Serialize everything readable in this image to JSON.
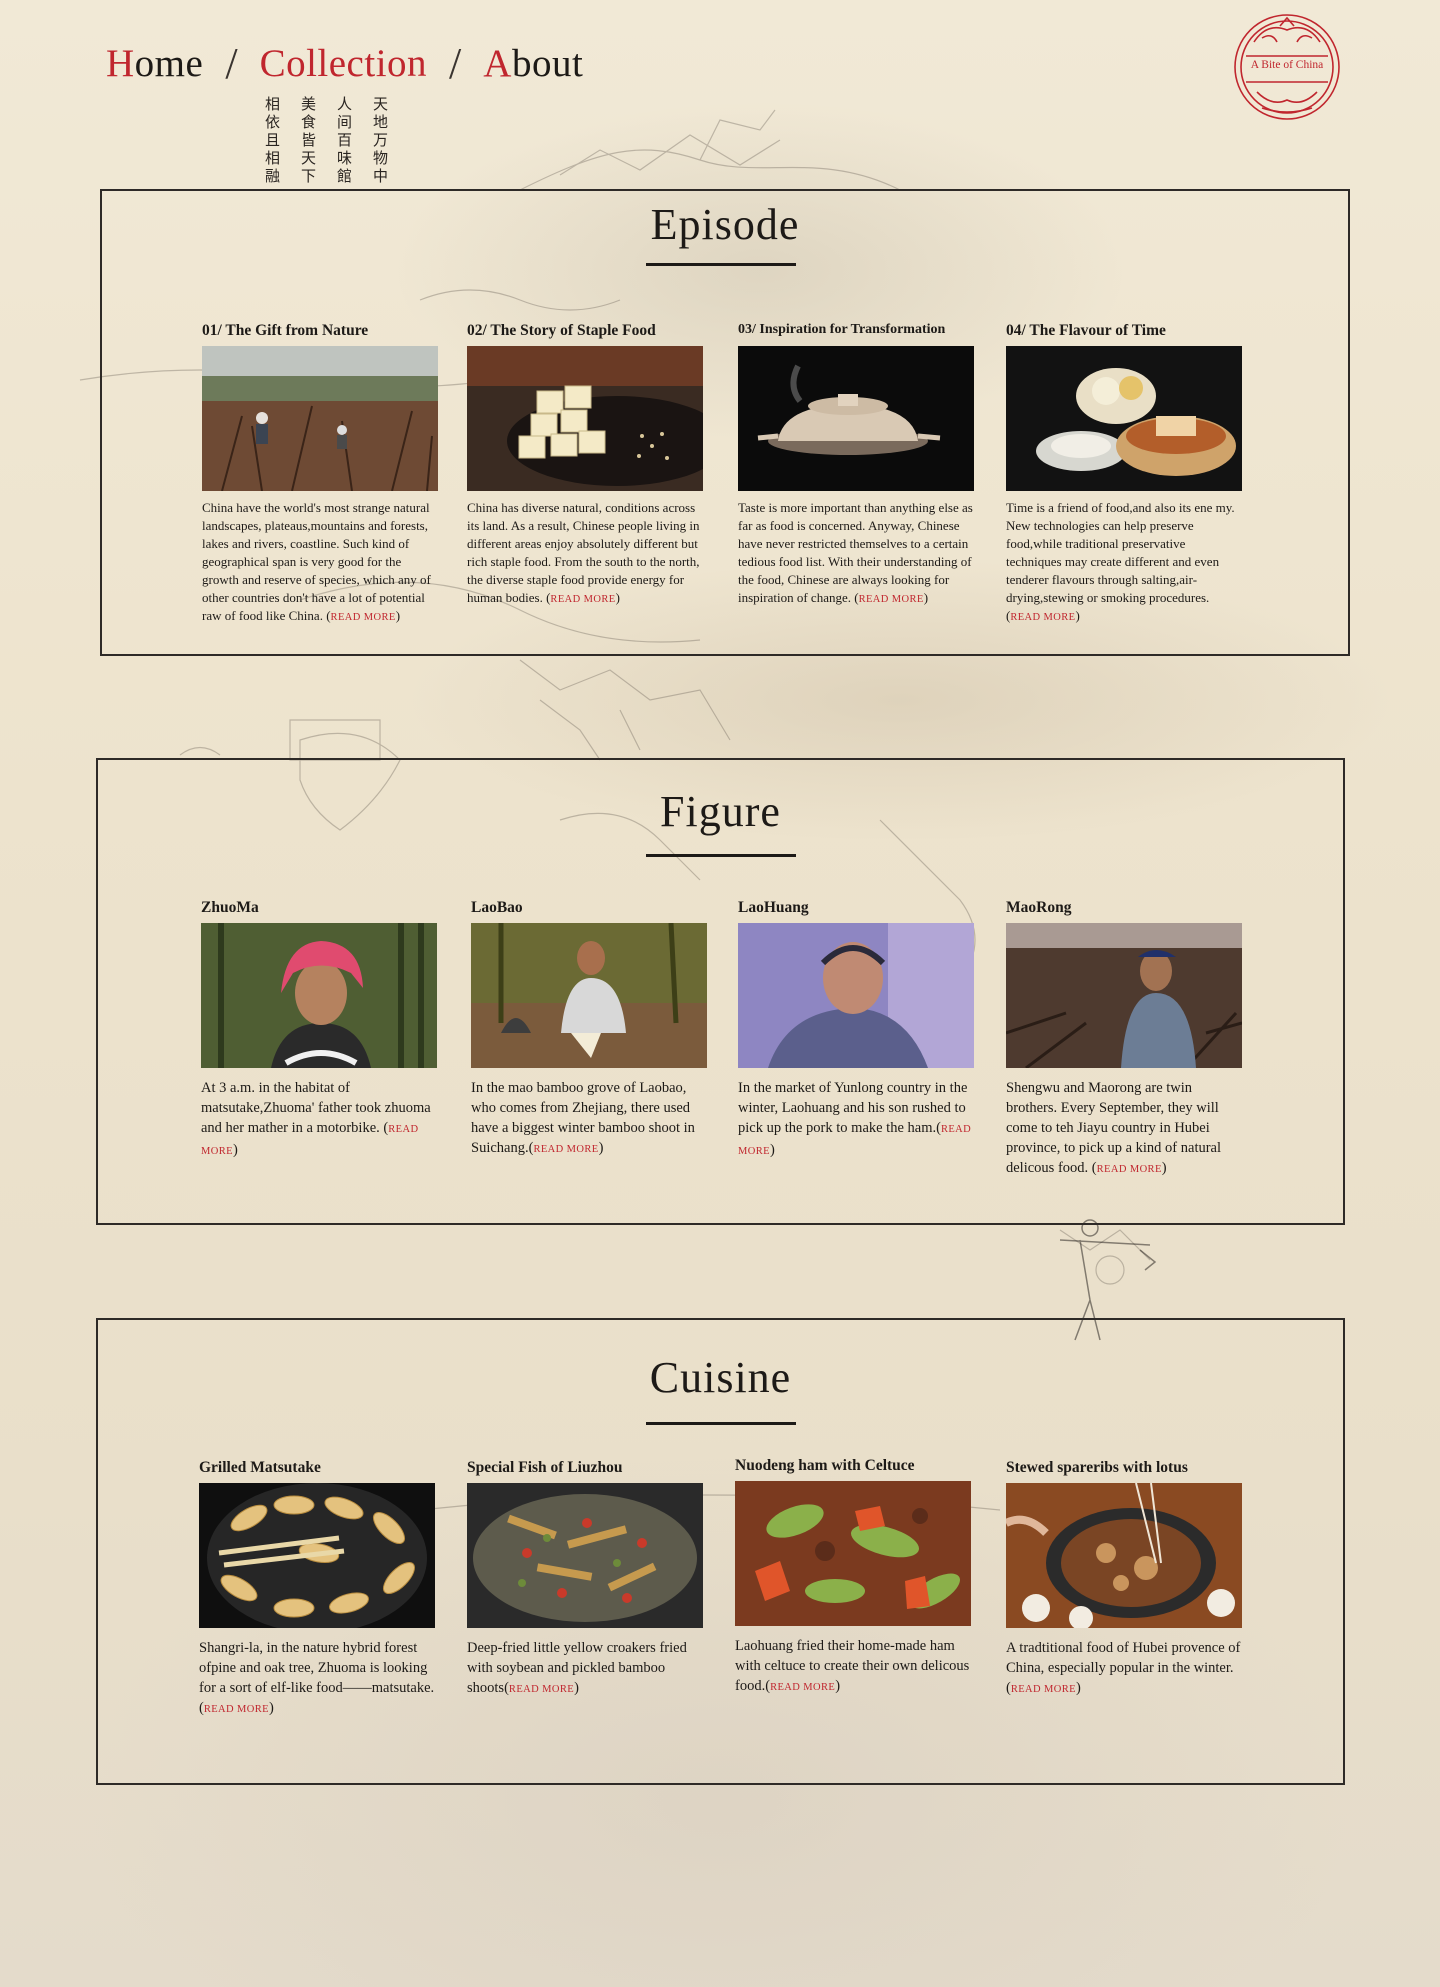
{
  "nav": {
    "home": {
      "first": "H",
      "rest": "ome"
    },
    "separator": "/",
    "collection": "Collection",
    "about": {
      "first": "A",
      "rest": "bout"
    }
  },
  "poem": [
    "天地万物中",
    "人间百味館",
    "美食皆天下",
    "相依且相融"
  ],
  "seal": {
    "text": "A Bite of China"
  },
  "read_more": "READ MORE",
  "episode": {
    "title": "Episode",
    "cards": [
      {
        "title": "01/  The Gift from Nature",
        "text": "China have the world's most strange natural landscapes, plateaus,mountains and forests, lakes and rivers, coastline. Such kind of geographical span is very good for the growth and reserve of species, which any of other countries don't have a lot of potential raw of food like China."
      },
      {
        "title": "02/ The Story of Staple Food",
        "text": "China has diverse natural, conditions across its land. As a result, Chinese people living in different areas enjoy absolutely different but rich staple food. From the south to the north, the diverse staple food provide energy for human bodies."
      },
      {
        "title": "03/ Inspiration for Transformation",
        "text": "Taste is more important than anything else as far as food is concerned. Anyway, Chinese have never restricted themselves to a certain tedious food list. With their understanding of the food, Chinese are always looking for inspiration of change."
      },
      {
        "title": "04/  The Flavour of Time",
        "text": "Time is a friend of food,and also its ene my. New technologies can help preserve food,while traditional preservative techniques may create different and even tenderer flavours through salting,air-drying,stewing or smoking procedures."
      }
    ]
  },
  "figure": {
    "title": "Figure",
    "cards": [
      {
        "title": "ZhuoMa",
        "text": "At 3 a.m. in the habitat of matsutake,Zhuoma' father took zhuoma and her mather in a motorbike."
      },
      {
        "title": "LaoBao",
        "text": "In the mao bamboo grove of Laobao, who comes from Zhejiang, there used have a biggest winter bamboo shoot in Suichang."
      },
      {
        "title": "LaoHuang",
        "text": "In the market of Yunlong country in the winter, Laohuang and his son rushed to pick up the pork to make the ham."
      },
      {
        "title": "MaoRong",
        "text": "Shengwu and Maorong are twin brothers. Every September, they will come to teh Jiayu country in Hubei province, to pick up a kind of natural delicous food."
      }
    ]
  },
  "cuisine": {
    "title": "Cuisine",
    "cards": [
      {
        "title": "Grilled Matsutake",
        "text": "Shangri-la, in the nature hybrid forest ofpine and oak tree, Zhuoma is looking for a sort of elf-like food——matsutake."
      },
      {
        "title": "Special Fish of Liuzhou",
        "text": "Deep-fried little yellow croakers fried with soybean and pickled bamboo shoots"
      },
      {
        "title": "Nuodeng ham with Celtuce",
        "text": "Laohuang fried their home-made ham with celtuce to create their own delicous food."
      },
      {
        "title": "Stewed spareribs with lotus",
        "text": "A tradtitional food of Hubei provence of China, especially popular in the winter."
      }
    ]
  },
  "colors": {
    "accent": "#c0262e",
    "ink": "#1d1a17",
    "paper": "#efe6d2"
  }
}
